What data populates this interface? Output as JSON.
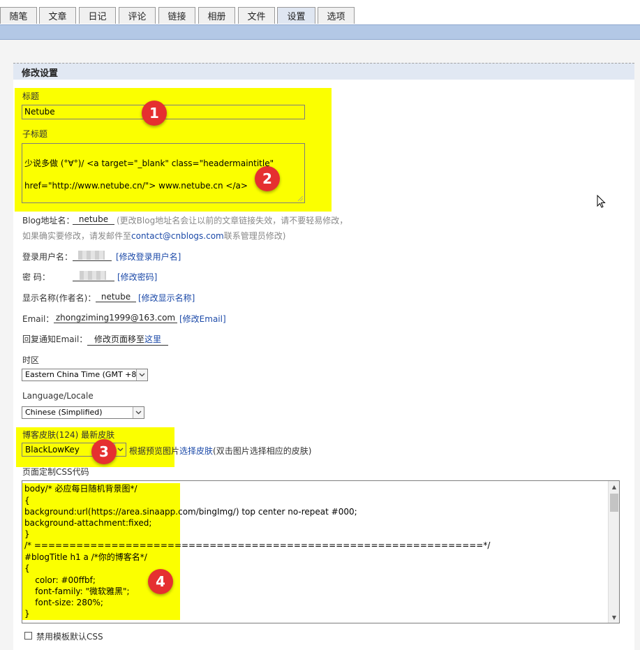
{
  "tabs": [
    {
      "label": "随笔",
      "active": false
    },
    {
      "label": "文章",
      "active": false
    },
    {
      "label": "日记",
      "active": false
    },
    {
      "label": "评论",
      "active": false
    },
    {
      "label": "链接",
      "active": false
    },
    {
      "label": "相册",
      "active": false
    },
    {
      "label": "文件",
      "active": false
    },
    {
      "label": "设置",
      "active": true
    },
    {
      "label": "选项",
      "active": false
    }
  ],
  "section_title": "修改设置",
  "title_field": {
    "label": "标题",
    "value": "Netube"
  },
  "subtitle_field": {
    "label": "子标题",
    "line1": "少说多做 (°∀°)/ <a target=\"_blank\" class=\"headermaintitle\"",
    "line2": "href=\"http://www.netube.cn/\"> www.netube.cn </a>"
  },
  "blog_address": {
    "label": "Blog地址名：",
    "value": "netube",
    "note1": "(更改Blog地址名会让以前的文章链接失效，请不要轻易修改，",
    "note2_pre": "如果确实要修改，请发邮件至",
    "email_link": "contact@cnblogs.com",
    "note2_post": "联系管理员修改)"
  },
  "login_user": {
    "label": "登录用户名：",
    "link": "[修改登录用户名]"
  },
  "password": {
    "label": "密        码：",
    "link": "[修改密码]"
  },
  "display_name": {
    "label": "显示名称(作者名)：",
    "value": "netube",
    "link": "[修改显示名称]"
  },
  "email": {
    "label": "Email：",
    "value": "zhongziming1999@163.com",
    "link": "[修改Email]"
  },
  "reply_email": {
    "label": "回复通知Email：",
    "value_pre": "修改页面移至",
    "value_link": "这里"
  },
  "timezone": {
    "label": "时区",
    "selected": "Eastern China Time (GMT +8)"
  },
  "language": {
    "label": "Language/Locale",
    "selected": "Chinese (Simplified)"
  },
  "skin": {
    "label": "博客皮肤(124) 最新皮肤",
    "selected": "BlackLowKey",
    "hint_pre": "根据预览图片",
    "hint_link": "选择皮肤",
    "hint_post": "(双击图片选择相应的皮肤)"
  },
  "css": {
    "label": "页面定制CSS代码",
    "lines": [
      "body/* 必应每日随机背景图*/",
      "{",
      "background:url(https://area.sinaapp.com/bingImg/) top center no-repeat #000;",
      "background-attachment:fixed;",
      "}",
      "/* ================================================================*/",
      "#blogTitle h1 a /*你的博客名*/",
      "{",
      "    color: #00ffbf;",
      "    font-family: \"微软雅黑\";",
      "    font-size: 280%;",
      "}"
    ]
  },
  "disable_default_css": {
    "label": "禁用模板默认CSS",
    "checked": false
  },
  "badges": [
    "1",
    "2",
    "3",
    "4"
  ],
  "colors": {
    "highlight": "#fbff00",
    "badge": "#e53030",
    "link": "#1b49a8",
    "band": "#b3c8e6"
  }
}
